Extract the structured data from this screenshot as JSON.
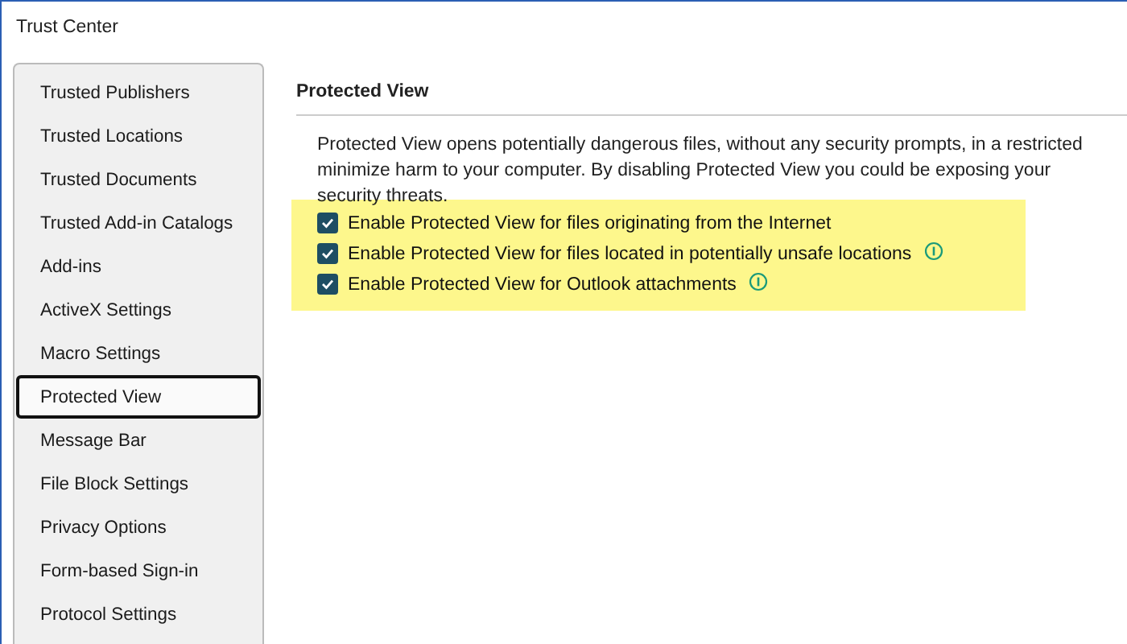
{
  "window": {
    "title": "Trust Center"
  },
  "sidebar": {
    "items": [
      {
        "label": "Trusted Publishers",
        "selected": false
      },
      {
        "label": "Trusted Locations",
        "selected": false
      },
      {
        "label": "Trusted Documents",
        "selected": false
      },
      {
        "label": "Trusted Add-in Catalogs",
        "selected": false
      },
      {
        "label": "Add-ins",
        "selected": false
      },
      {
        "label": "ActiveX Settings",
        "selected": false
      },
      {
        "label": "Macro Settings",
        "selected": false
      },
      {
        "label": "Protected View",
        "selected": true
      },
      {
        "label": "Message Bar",
        "selected": false
      },
      {
        "label": "File Block Settings",
        "selected": false
      },
      {
        "label": "Privacy Options",
        "selected": false
      },
      {
        "label": "Form-based Sign-in",
        "selected": false
      },
      {
        "label": "Protocol Settings",
        "selected": false
      }
    ]
  },
  "section": {
    "title": "Protected View",
    "description_lines": [
      "Protected View opens potentially dangerous files, without any security prompts, in a restricted",
      "minimize harm to your computer. By disabling Protected View you could be exposing your",
      "security threats."
    ],
    "options": [
      {
        "label": "Enable Protected View for files originating from the Internet",
        "checked": true,
        "info": false
      },
      {
        "label": "Enable Protected View for files located in potentially unsafe locations",
        "checked": true,
        "info": true
      },
      {
        "label": "Enable Protected View for Outlook attachments",
        "checked": true,
        "info": true
      }
    ]
  }
}
